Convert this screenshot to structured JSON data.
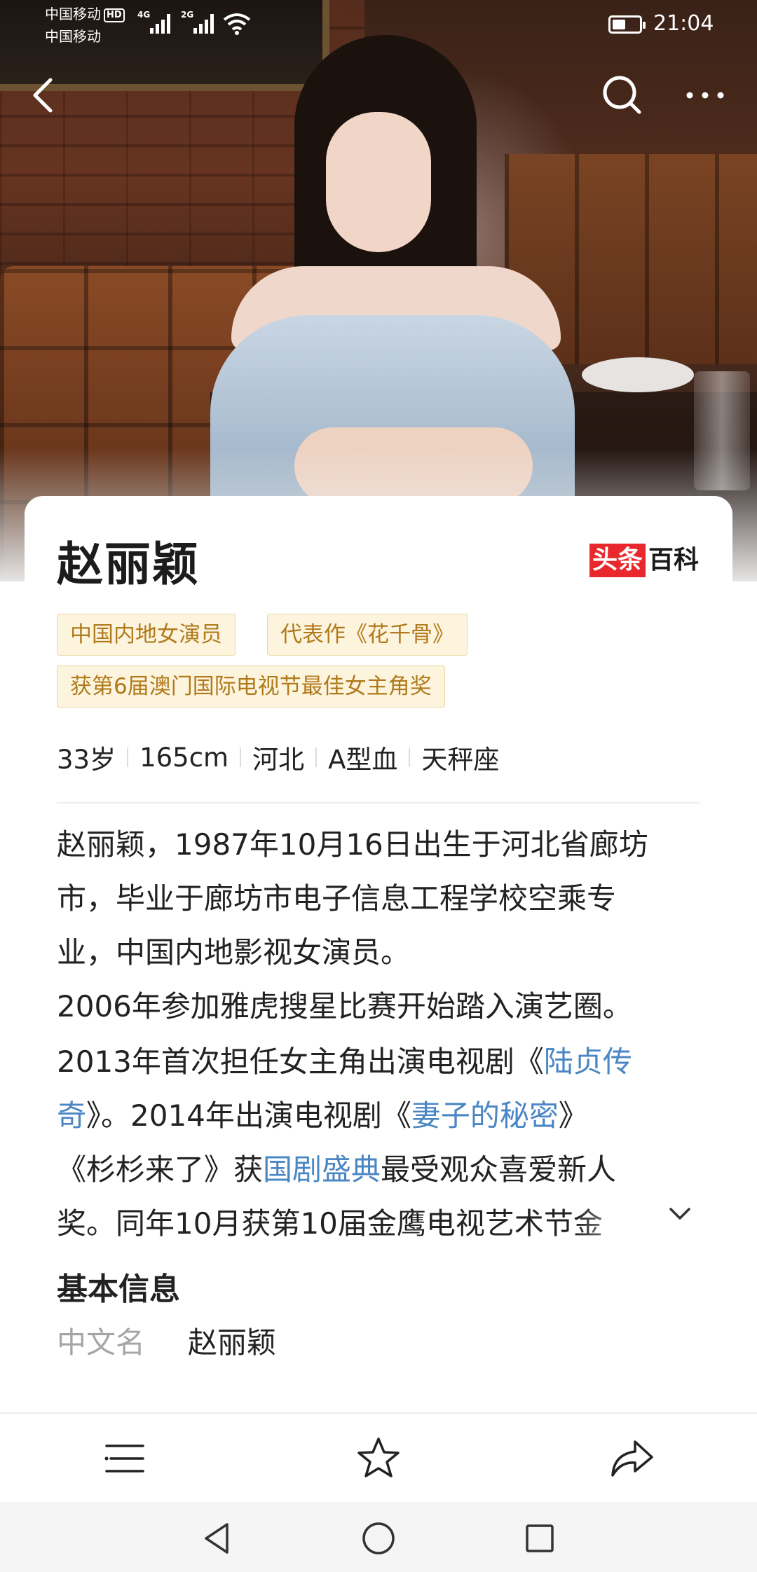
{
  "status_bar": {
    "carrier1": "中国移动",
    "carrier1_badge": "HD",
    "carrier2": "中国移动",
    "net1": "4G",
    "net2": "2G",
    "time": "21:04"
  },
  "icons": {
    "back": "back-arrow-icon",
    "search": "search-icon",
    "more": "more-dots-icon",
    "expand": "chevron-down-icon",
    "catalog": "list-icon",
    "favorite": "star-icon",
    "share": "share-icon",
    "sys_back": "triangle-back-icon",
    "sys_home": "circle-home-icon",
    "sys_recent": "square-recent-icon"
  },
  "article": {
    "title": "赵丽颖",
    "logo_red": "头条",
    "logo_black": "百科",
    "tags": [
      "中国内地女演员",
      "代表作《花千骨》",
      "获第6届澳门国际电视节最佳女主角奖"
    ],
    "facts": [
      "33岁",
      "165cm",
      "河北",
      "A型血",
      "天秤座"
    ],
    "summary": {
      "line1": "赵丽颖，1987年10月16日出生于河北省廊坊",
      "line2": "市，毕业于廊坊市电子信息工程学校空乘专",
      "line3": "业，中国内地影视女演员。",
      "line4": "2006年参加雅虎搜星比赛开始踏入演艺圈。",
      "line5_a": "2013年首次担任女主角出演电视剧《",
      "line5_link": "陆贞传",
      "line6_link": "奇",
      "line6_b": "》。2014年出演电视剧《",
      "line6_link2": "妻子的秘密",
      "line6_c": "》",
      "line7_a": "《杉杉来了》获",
      "line7_link": "国剧盛典",
      "line7_b": "最受观众喜爱新人",
      "line8": "奖。同年10月获第10届金鹰电视艺术节金"
    },
    "basic_info_title": "基本信息",
    "info": [
      {
        "key": "中文名",
        "value": "赵丽颖"
      }
    ]
  },
  "colors": {
    "link": "#4a86c4",
    "tag_text": "#b07a1c",
    "tag_bg": "#fdf4dd",
    "logo_red": "#e8282c"
  }
}
